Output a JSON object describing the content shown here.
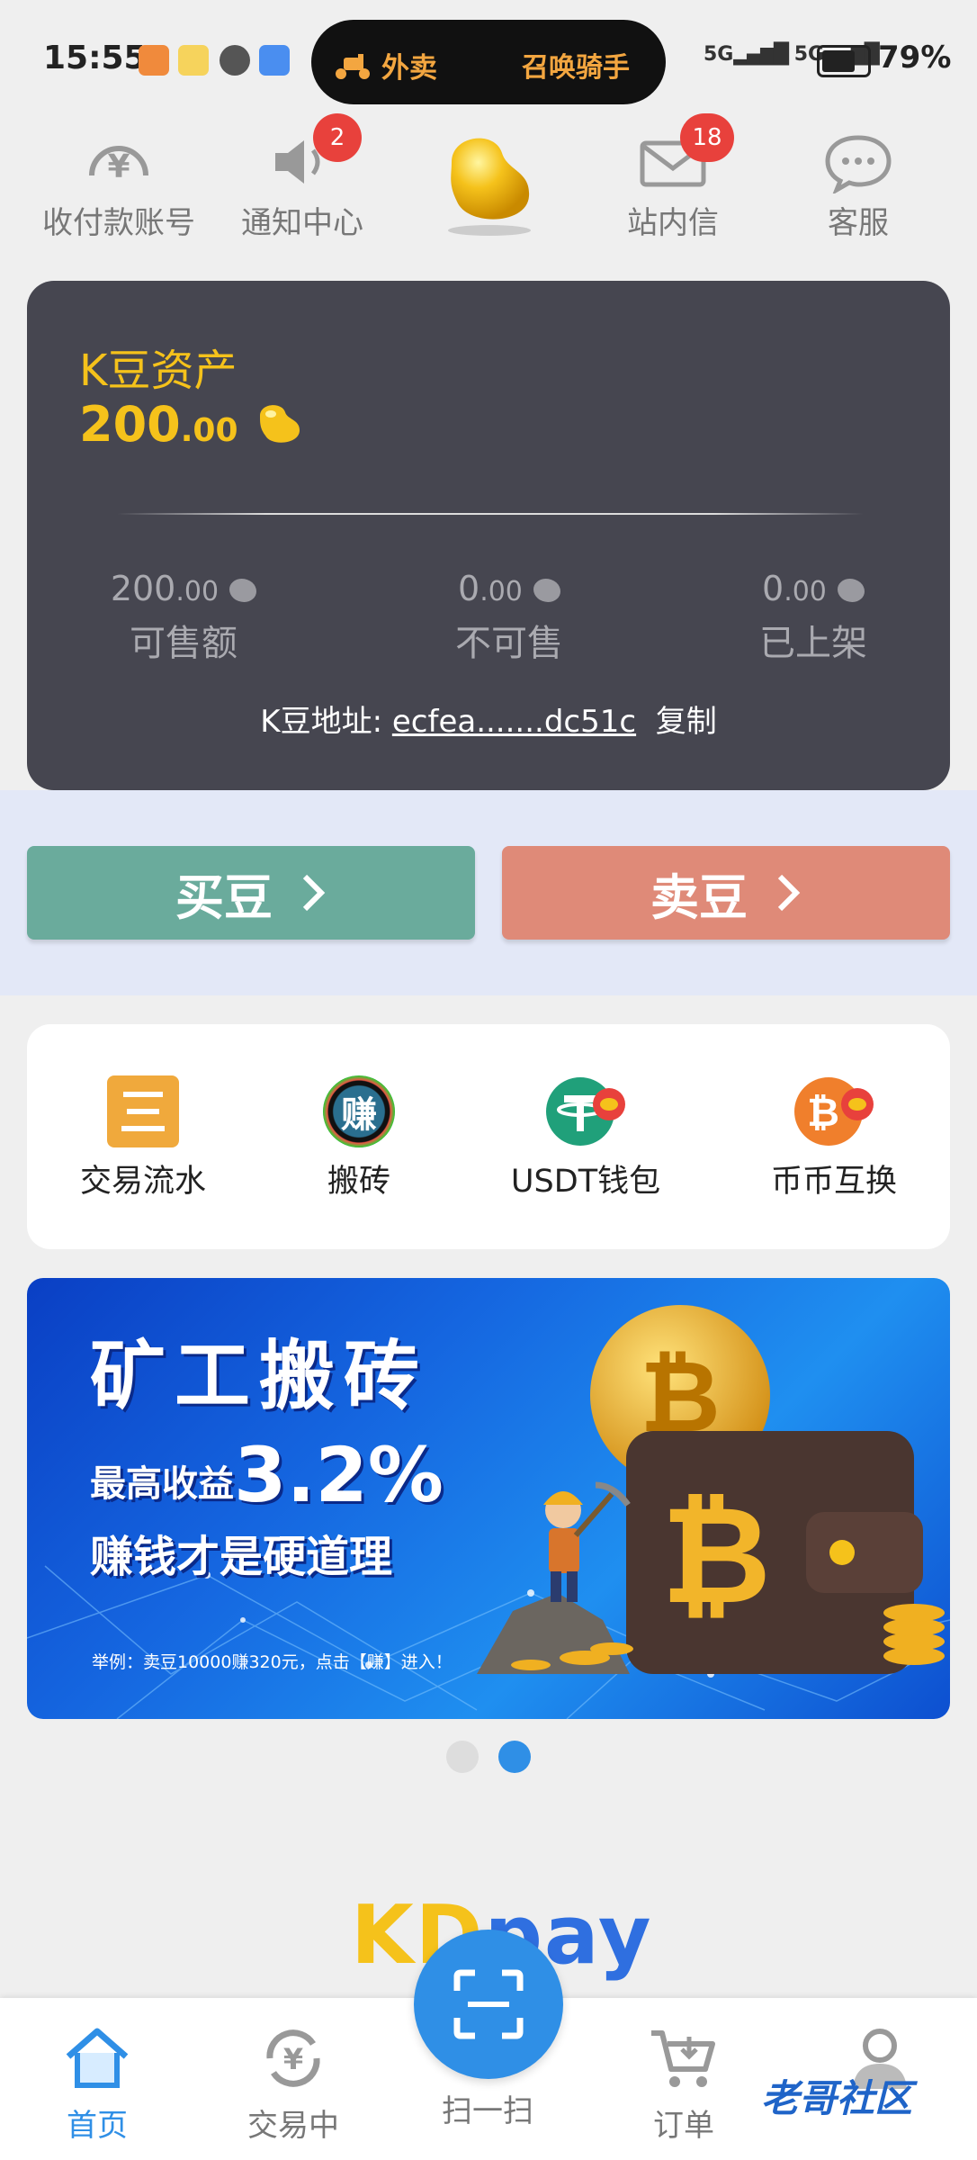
{
  "status_bar": {
    "time": "15:55",
    "pill_left": "外卖",
    "pill_right": "召唤骑手",
    "signal1": "5G",
    "signal2": "5G",
    "battery": "79%"
  },
  "top_nav": [
    {
      "label": "收付款账号",
      "icon": "yen-icon"
    },
    {
      "label": "通知中心",
      "icon": "speaker-icon",
      "badge": "2"
    },
    {
      "label": "",
      "icon": "gold-bean-logo"
    },
    {
      "label": "站内信",
      "icon": "mail-icon",
      "badge": "18"
    },
    {
      "label": "客服",
      "icon": "chat-icon"
    }
  ],
  "asset_card": {
    "title": "K豆资产",
    "amount_int": "200",
    "amount_dec": ".00",
    "stats": [
      {
        "int": "200",
        "dec": ".00",
        "label": "可售额"
      },
      {
        "int": "0",
        "dec": ".00",
        "label": "不可售"
      },
      {
        "int": "0",
        "dec": ".00",
        "label": "已上架"
      }
    ],
    "address_label": "K豆地址:",
    "address_value": "ecfea.......dc51c",
    "copy_label": "复制"
  },
  "actions": {
    "buy": "买豆",
    "sell": "卖豆",
    "buy_color": "#6aab9c",
    "sell_color": "#df8a78"
  },
  "quick_menu": [
    {
      "label": "交易流水",
      "icon": "ledger-icon"
    },
    {
      "label": "搬砖",
      "icon": "earn-icon",
      "icon_text": "赚"
    },
    {
      "label": "USDT钱包",
      "icon": "usdt-icon"
    },
    {
      "label": "币币互换",
      "icon": "bitcoin-swap-icon"
    }
  ],
  "banner": {
    "line1": "矿工搬砖",
    "line2_prefix": "最高收益",
    "line2_value": "3.2%",
    "line3": "赚钱才是硬道理",
    "footnote": "举例：卖豆10000赚320元，点击【赚】进入！"
  },
  "carousel": {
    "count": 2,
    "active_index": 1
  },
  "logo": {
    "part1": "KD",
    "part2": "pay"
  },
  "bottom_tabs": [
    {
      "label": "首页",
      "icon": "home-icon",
      "active": true
    },
    {
      "label": "交易中",
      "icon": "yen-refresh-icon"
    },
    {
      "label": "扫一扫",
      "icon": "scan-icon"
    },
    {
      "label": "订单",
      "icon": "cart-icon"
    },
    {
      "label": "",
      "icon": "user-icon"
    }
  ],
  "watermark": "老哥社区",
  "colors": {
    "accent": "#2f8fe6",
    "gold": "#f5c21b",
    "card_bg": "#464650",
    "badge": "#e8413c"
  }
}
